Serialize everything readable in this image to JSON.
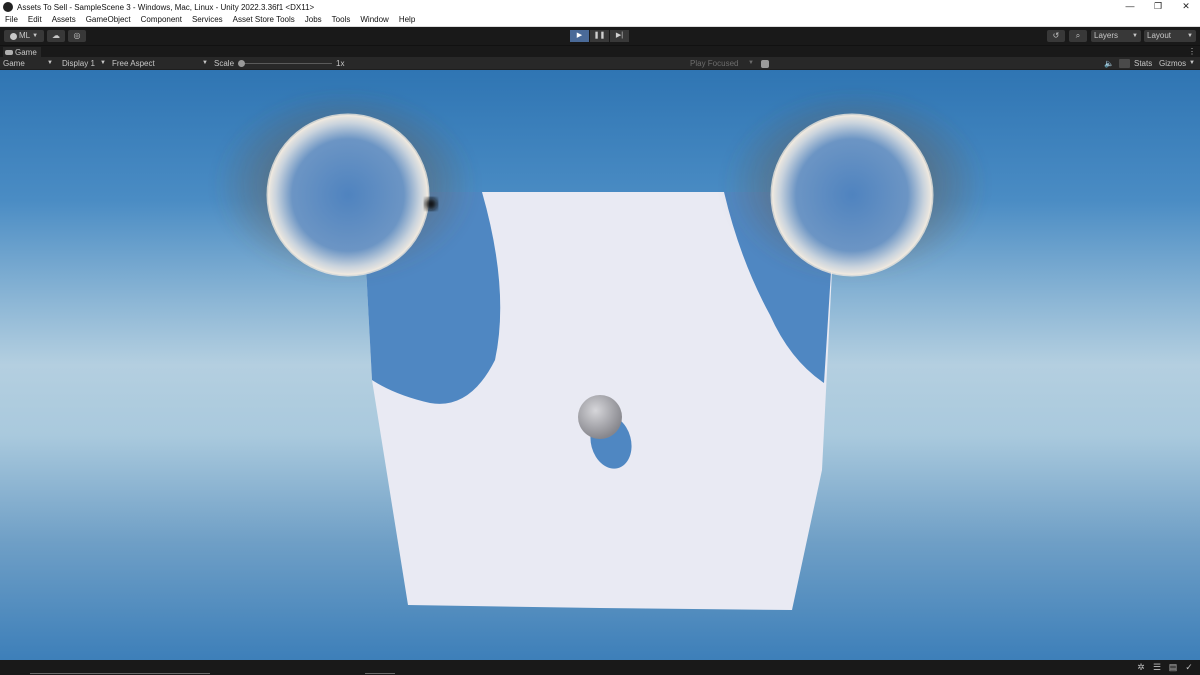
{
  "window": {
    "title": "Assets To Sell - SampleScene 3 - Windows, Mac, Linux - Unity 2022.3.36f1 <DX11>",
    "controls": [
      "—",
      "❐",
      "✕"
    ]
  },
  "menu": [
    "File",
    "Edit",
    "Assets",
    "GameObject",
    "Component",
    "Services",
    "Asset Store Tools",
    "Jobs",
    "Tools",
    "Window",
    "Help"
  ],
  "toolbar": {
    "account_label": "ML",
    "play_glyph": "▶",
    "pause_glyph": "❚❚",
    "step_glyph": "▶|",
    "layers_label": "Layers",
    "layout_label": "Layout",
    "play_active": true
  },
  "tab": {
    "label": "Game"
  },
  "gamebar": {
    "mode": "Game",
    "display": "Display 1",
    "aspect": "Free Aspect",
    "scale_label": "Scale",
    "scale_value": "1x",
    "play_focused": "Play Focused",
    "stats": "Stats",
    "gizmos": "Gizmos"
  },
  "colors": {
    "accent": "#4a6a98",
    "editor_bg": "#191919",
    "panel_bg": "#282828",
    "sky_top": "#2f75b3",
    "horizon": "#b4cfe0",
    "plane": "#e9eaf3"
  },
  "icons": {
    "unity_logo": "unity-logo-icon",
    "cloud": "cloud-icon",
    "collab": "collab-icon",
    "history": "history-icon",
    "search": "search-icon",
    "audio": "audio-mute-icon",
    "stats": "stats-icon",
    "bug": "bug-icon"
  }
}
